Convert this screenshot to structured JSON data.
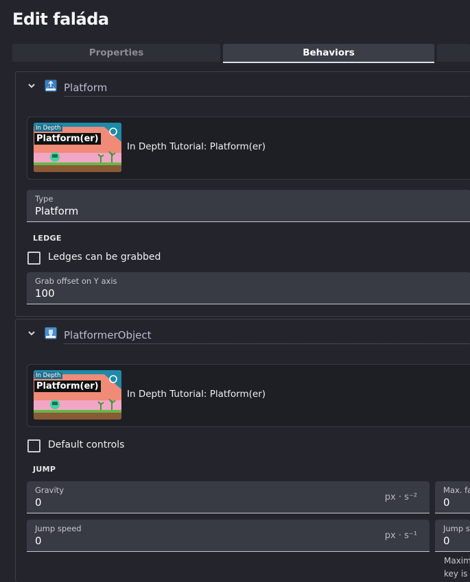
{
  "dialog": {
    "title": "Edit faláda"
  },
  "tabs": [
    {
      "label": "Properties",
      "active": false
    },
    {
      "label": "Behaviors",
      "active": true
    }
  ],
  "behaviors": [
    {
      "name": "Platform",
      "icon": "platform-behavior-icon",
      "tutorial": {
        "badge": "In Depth",
        "thumb_title": "Platform(er)",
        "label": "In Depth Tutorial: Platform(er)"
      },
      "type_field": {
        "label": "Type",
        "value": "Platform"
      },
      "ledge": {
        "heading": "LEDGE",
        "checkbox_label": "Ledges can be grabbed",
        "checked": false,
        "grab_offset": {
          "label": "Grab offset on Y axis",
          "value": "100"
        }
      }
    },
    {
      "name": "PlatformerObject",
      "icon": "platformer-object-behavior-icon",
      "tutorial": {
        "badge": "In Depth",
        "thumb_title": "Platform(er)",
        "label": "In Depth Tutorial: Platform(er)"
      },
      "default_controls": {
        "label": "Default controls",
        "checked": false
      },
      "jump": {
        "heading": "JUMP",
        "gravity": {
          "label": "Gravity",
          "value": "0",
          "unit": "px · s⁻²"
        },
        "max_falling": {
          "label": "Max. fal",
          "value": "0"
        },
        "jump_speed": {
          "label": "Jump speed",
          "value": "0",
          "unit": "px · s⁻¹"
        },
        "jump_sustain": {
          "label": "Jump su",
          "value": "0"
        },
        "sustain_note_1": "Maxim",
        "sustain_note_2": "key is"
      }
    }
  ],
  "colors": {
    "background": "#24252c",
    "field": "#383a44",
    "accent_text": "#b9bbd2",
    "thumb_teal": "#1f8aa8",
    "thumb_salmon": "#f08b78"
  }
}
